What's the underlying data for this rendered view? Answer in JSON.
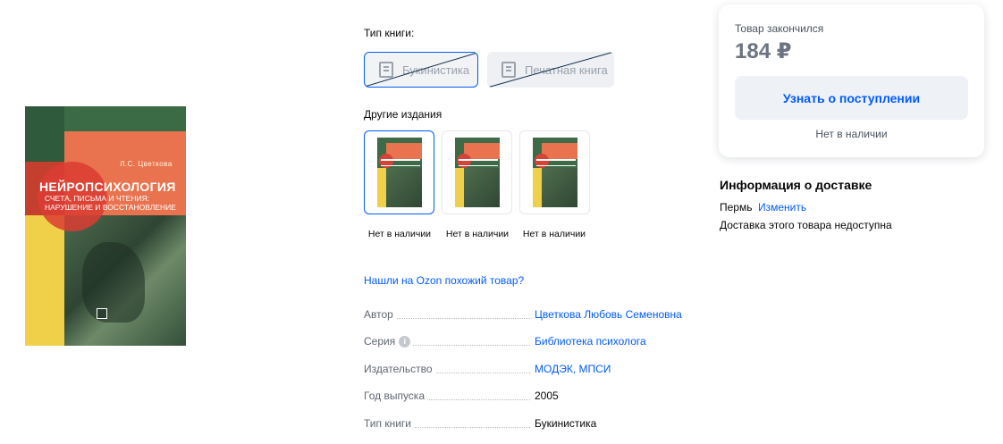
{
  "book_cover": {
    "author": "Л.С. Цветкова",
    "title": "НЕЙРОПСИХОЛОГИЯ",
    "subtitle": "Счета, письма и чтения: нарушение и восстановление"
  },
  "book_type_selector": {
    "label": "Тип книги:",
    "options": [
      {
        "label": "Букинистика",
        "selected": true,
        "unavailable": true,
        "icon": "used-book-icon"
      },
      {
        "label": "Печатная книга",
        "selected": false,
        "unavailable": true,
        "icon": "printed-book-icon"
      }
    ]
  },
  "other_editions": {
    "label": "Другие издания",
    "items": [
      {
        "status": "Нет в наличии",
        "selected": true
      },
      {
        "status": "Нет в наличии",
        "selected": false
      },
      {
        "status": "Нет в наличии",
        "selected": false
      }
    ]
  },
  "similar_link": "Нашли на Ozon похожий товар?",
  "specs": [
    {
      "key": "Автор",
      "value": "Цветкова Любовь Семеновна",
      "link": true,
      "info": false
    },
    {
      "key": "Серия",
      "value": "Библиотека психолога",
      "link": true,
      "info": true
    },
    {
      "key": "Издательство",
      "value": "МОДЭК, МПСИ",
      "link": true,
      "info": false
    },
    {
      "key": "Год выпуска",
      "value": "2005",
      "link": false,
      "info": false
    },
    {
      "key": "Тип книги",
      "value": "Букинистика",
      "link": false,
      "info": false
    }
  ],
  "price_card": {
    "status": "Товар закончился",
    "price": "184 ₽",
    "notify_button": "Узнать о поступлении",
    "stock_text": "Нет в наличии"
  },
  "delivery": {
    "title": "Информация о доставке",
    "city": "Пермь",
    "change_link": "Изменить",
    "note": "Доставка этого товара недоступна"
  },
  "colors": {
    "accent": "#005bff",
    "text": "#070707",
    "muted": "#5f6672"
  }
}
